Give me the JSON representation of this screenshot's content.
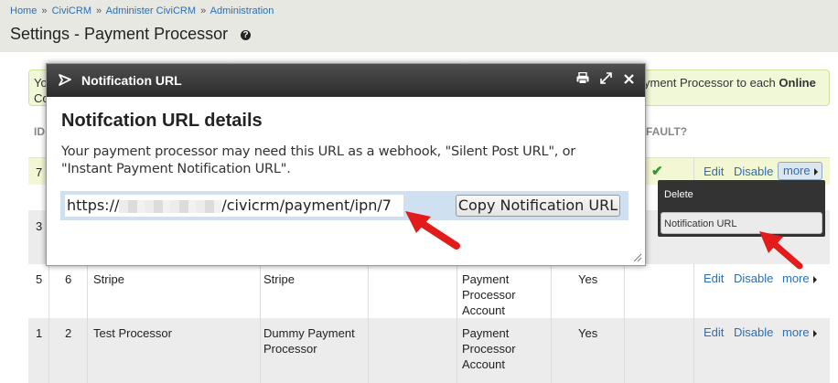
{
  "breadcrumb": {
    "items": [
      "Home",
      "CiviCRM",
      "Administer CiviCRM",
      "Administration"
    ],
    "separator": "»"
  },
  "page": {
    "title": "Settings - Payment Processor"
  },
  "message": {
    "left_line1": "Yo",
    "left_line2": "Co",
    "right_text": "yment Processor to each ",
    "right_bold": "Online",
    "right_line2": ""
  },
  "columns": {
    "id": "ID",
    "default": "FAULT?"
  },
  "rows": [
    {
      "id": "7",
      "edit": "Edit",
      "disable": "Disable",
      "more": "more"
    },
    {
      "id": "3"
    },
    {
      "id": "5",
      "col2": "6",
      "name": "Stripe",
      "type": "Stripe",
      "financial": [
        "Payment",
        "Processor",
        "Account"
      ],
      "enabled": "Yes",
      "edit": "Edit",
      "disable": "Disable",
      "more": "more"
    },
    {
      "id": "1",
      "col2": "2",
      "name": "Test Processor",
      "type": [
        "Dummy Payment",
        "Processor"
      ],
      "financial": [
        "Payment",
        "Processor",
        "Account"
      ],
      "enabled": "Yes",
      "edit": "Edit",
      "disable": "Disable",
      "more": "more"
    }
  ],
  "dropdown": {
    "delete": "Delete",
    "notification_url": "Notification URL"
  },
  "modal": {
    "title": "Notification URL",
    "heading": "Notifcation URL details",
    "description_line1": "Your payment processor may need this URL as a webhook, \"Silent Post URL\", or",
    "description_line2": "\"Instant Payment Notification URL\".",
    "url_prefix": "https://",
    "url_suffix": "/civicrm/payment/ipn/7",
    "copy_button": "Copy Notification URL"
  },
  "colors": {
    "link": "#2a6fb5",
    "highlight_row": "#f4f7d3",
    "arrow": "#e41b1b",
    "titlebar": "#3a3a3a"
  }
}
